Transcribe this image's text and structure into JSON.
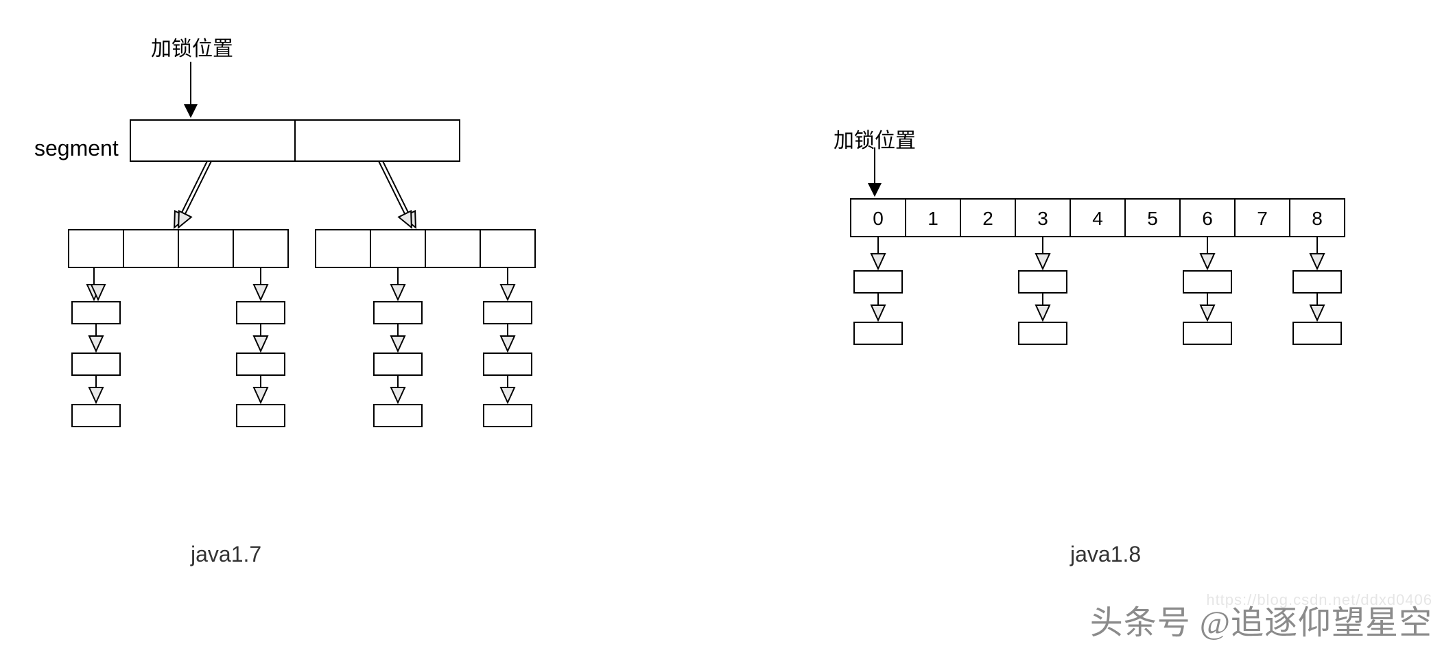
{
  "left": {
    "lock_label": "加锁位置",
    "segment_label": "segment",
    "caption": "java1.7",
    "segments": 2,
    "buckets_per_segment": 4,
    "chain_depth": 3
  },
  "right": {
    "lock_label": "加锁位置",
    "caption": "java1.8",
    "buckets": [
      "0",
      "1",
      "2",
      "3",
      "4",
      "5",
      "6",
      "7",
      "8"
    ],
    "chains": [
      {
        "bucket_index": 0,
        "depth": 2
      },
      {
        "bucket_index": 3,
        "depth": 2
      },
      {
        "bucket_index": 6,
        "depth": 2
      },
      {
        "bucket_index": 8,
        "depth": 2
      }
    ]
  },
  "watermark": "头条号 @追逐仰望星空",
  "faint_url": "https://blog.csdn.net/ddxd0406"
}
